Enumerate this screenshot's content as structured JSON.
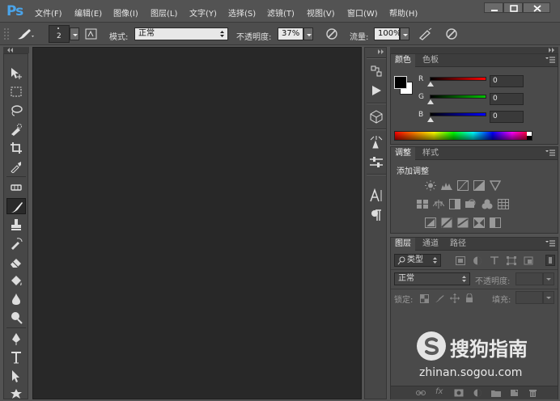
{
  "app": {
    "logo": "Ps"
  },
  "menu": [
    {
      "label": "文件(F)"
    },
    {
      "label": "编辑(E)"
    },
    {
      "label": "图像(I)"
    },
    {
      "label": "图层(L)"
    },
    {
      "label": "文字(Y)"
    },
    {
      "label": "选择(S)"
    },
    {
      "label": "滤镜(T)"
    },
    {
      "label": "视图(V)"
    },
    {
      "label": "窗口(W)"
    },
    {
      "label": "帮助(H)"
    }
  ],
  "options": {
    "brush_size": "2",
    "mode_label": "模式:",
    "mode_value": "正常",
    "opacity_label": "不透明度:",
    "opacity_value": "37%",
    "flow_label": "流量:",
    "flow_value": "100%"
  },
  "color_panel": {
    "tabs": [
      "颜色",
      "色板"
    ],
    "channels": [
      {
        "label": "R",
        "value": "0",
        "color": "#ff0000"
      },
      {
        "label": "G",
        "value": "0",
        "color": "#00c000"
      },
      {
        "label": "B",
        "value": "0",
        "color": "#0000ff"
      }
    ],
    "foreground": "#000000",
    "background": "#ffffff"
  },
  "adjust_panel": {
    "tabs": [
      "调整",
      "样式"
    ],
    "title": "添加调整"
  },
  "layers_panel": {
    "tabs": [
      "图层",
      "通道",
      "路径"
    ],
    "filter_label": "类型",
    "blend_mode": "正常",
    "opacity_label": "不透明度:",
    "lock_label": "锁定:",
    "fill_label": "填充:"
  },
  "watermark": {
    "brand": "搜狗指南",
    "url": "zhinan.sogou.com"
  },
  "colors": {
    "accent": "#4aa4ea",
    "bg": "#535353",
    "canvas": "#282828"
  }
}
